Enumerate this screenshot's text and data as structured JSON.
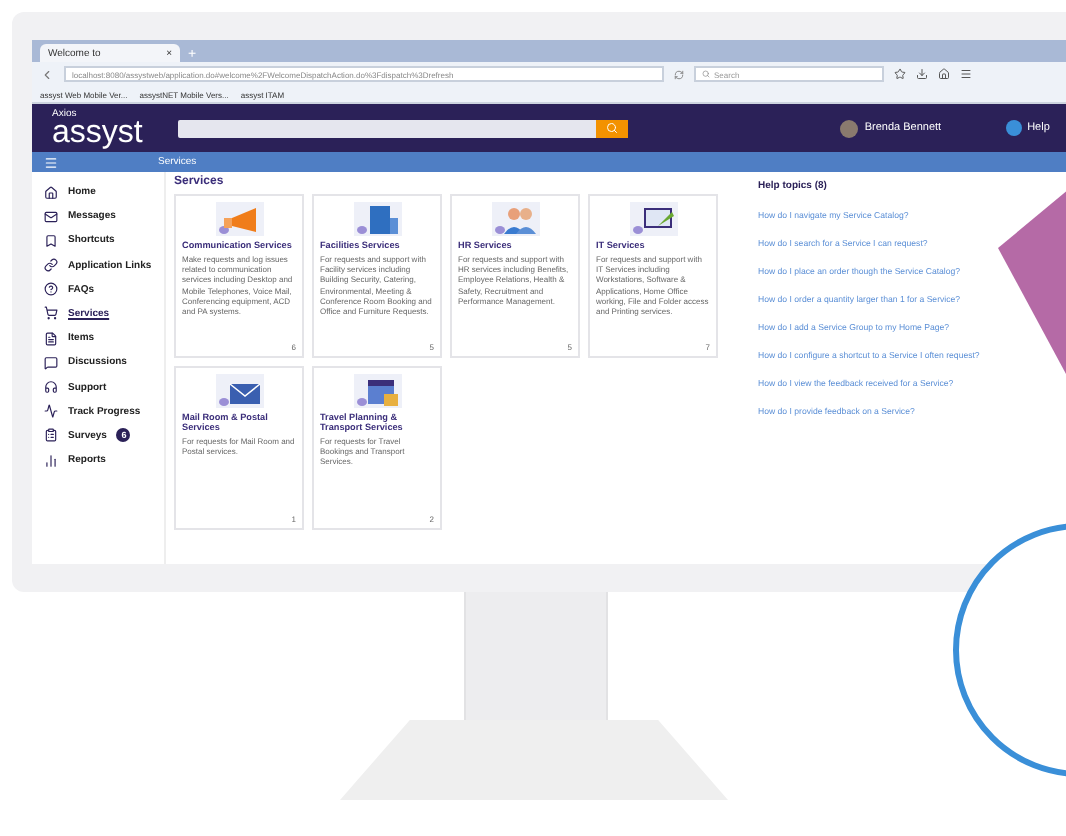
{
  "browser": {
    "tab": {
      "title": "Welcome to",
      "close": "×"
    },
    "new_tab": "+",
    "url": "localhost:8080/assystweb/application.do#welcome%2FWelcomeDispatchAction.do%3Fdispatch%3Drefresh",
    "search": {
      "placeholder": "Search"
    },
    "bookmarks": [
      "assyst Web Mobile Ver...",
      "assystNET Mobile Vers...",
      "assyst ITAM"
    ]
  },
  "header": {
    "logo_small": "Axios",
    "logo": "assyst",
    "user": "Brenda Bennett",
    "help": "Help"
  },
  "nav": {
    "title": "Services"
  },
  "sidebar": {
    "items": [
      {
        "label": "Home",
        "selected": false
      },
      {
        "label": "Messages",
        "selected": false
      },
      {
        "label": "Shortcuts",
        "selected": false
      },
      {
        "label": "Application Links",
        "selected": false
      },
      {
        "label": "FAQs",
        "selected": false
      },
      {
        "label": "Services",
        "selected": true
      },
      {
        "label": "Items",
        "selected": false
      },
      {
        "label": "Discussions",
        "selected": false
      },
      {
        "label": "Support",
        "selected": false
      },
      {
        "label": "Track Progress",
        "selected": false
      },
      {
        "label": "Surveys",
        "selected": false,
        "badge": "6"
      },
      {
        "label": "Reports",
        "selected": false
      }
    ]
  },
  "services": {
    "title": "Services",
    "cards": [
      {
        "kind": "megaphone",
        "title": "Communication Services",
        "description": "Make requests and log issues related to communication services including Desktop and Mobile Telephones, Voice Mail, Conferencing equipment, ACD and PA systems.",
        "count": "6"
      },
      {
        "kind": "building",
        "title": "Facilities Services",
        "description": "For requests and support with Facility services including Building Security, Catering, Environmental, Meeting & Conference Room Booking and Office and Furniture Requests.",
        "count": "5"
      },
      {
        "kind": "people",
        "title": "HR Services",
        "description": "For requests and support with HR services including Benefits, Employee Relations, Health & Safety, Recruitment and Performance Management.",
        "count": "5"
      },
      {
        "kind": "laptop",
        "title": "IT Services",
        "description": "For requests and support with IT Services including Workstations, Software & Applications, Home Office working, File and Folder access and Printing services.",
        "count": "7"
      },
      {
        "kind": "envelope",
        "title": "Mail Room & Postal Services",
        "description": "For requests for Mail Room and Postal services.",
        "count": "1"
      },
      {
        "kind": "calendar",
        "title": "Travel Planning & Transport Services",
        "description": "For requests for Travel Bookings and Transport Services.",
        "count": "2"
      }
    ]
  },
  "help": {
    "title": "Help topics (8)",
    "links": [
      "How do I navigate my Service Catalog?",
      "How do I search for a Service I can request?",
      "How do I place an order though the Service Catalog?",
      "How do I order a quantity larger than 1 for a Service?",
      "How do I add a Service Group to my Home Page?",
      "How do I configure a shortcut to a Service I often request?",
      "How do I view the feedback received for a Service?",
      "How do I provide feedback on a Service?"
    ]
  }
}
